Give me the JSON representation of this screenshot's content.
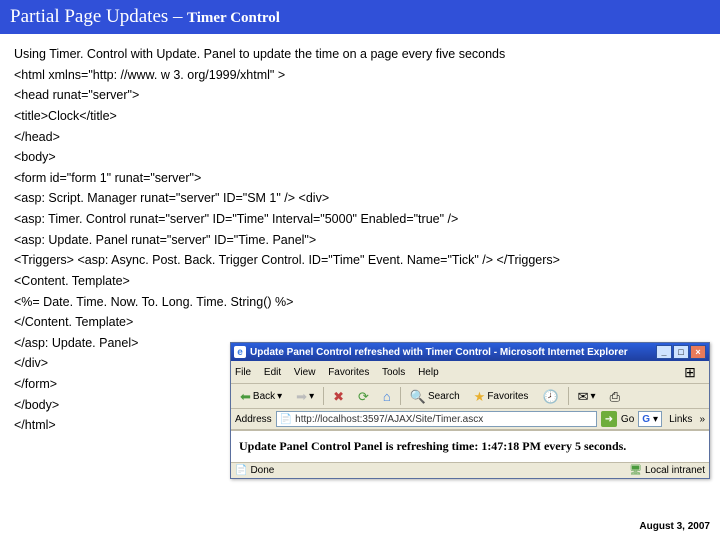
{
  "header": {
    "title": "Partial Page Updates –",
    "subtitle": "Timer Control"
  },
  "intro": "Using Timer. Control with Update. Panel to update the time on a page every five seconds",
  "code": [
    "<html xmlns=\"http: //www. w 3. org/1999/xhtml\" >",
    " <head runat=\"server\">",
    "<title>Clock</title>",
    "</head>",
    "<body>",
    "<form id=\"form 1\" runat=\"server\">",
    "<asp: Script. Manager runat=\"server\" ID=\"SM 1\" /> <div>",
    "<asp: Timer. Control runat=\"server\" ID=\"Time\" Interval=\"5000\" Enabled=\"true\" />",
    "<asp: Update. Panel runat=\"server\" ID=\"Time. Panel\">",
    "<Triggers> <asp: Async. Post. Back. Trigger Control. ID=\"Time\" Event. Name=\"Tick\" /> </Triggers>",
    "<Content. Template>",
    "<%= Date. Time. Now. To. Long. Time. String() %>",
    "</Content. Template>",
    "</asp: Update. Panel>",
    "</div>",
    "</form>",
    "</body>",
    "</html>"
  ],
  "footer_date": "August 3, 2007",
  "ie": {
    "title": "Update Panel Control refreshed with Timer Control - Microsoft Internet Explorer",
    "menu": {
      "file": "File",
      "edit": "Edit",
      "view": "View",
      "favorites": "Favorites",
      "tools": "Tools",
      "help": "Help"
    },
    "toolbar": {
      "back": "Back",
      "search": "Search",
      "favorites": "Favorites"
    },
    "address_label": "Address",
    "address_url": "http://localhost:3597/AJAX/Site/Timer.ascx",
    "go_text": "Go",
    "google_label": "G",
    "links_label": "Links",
    "page_text": "Update Panel Control Panel is refreshing time: 1:47:18 PM every 5 seconds.",
    "status_done": "Done",
    "status_zone": "Local intranet"
  }
}
